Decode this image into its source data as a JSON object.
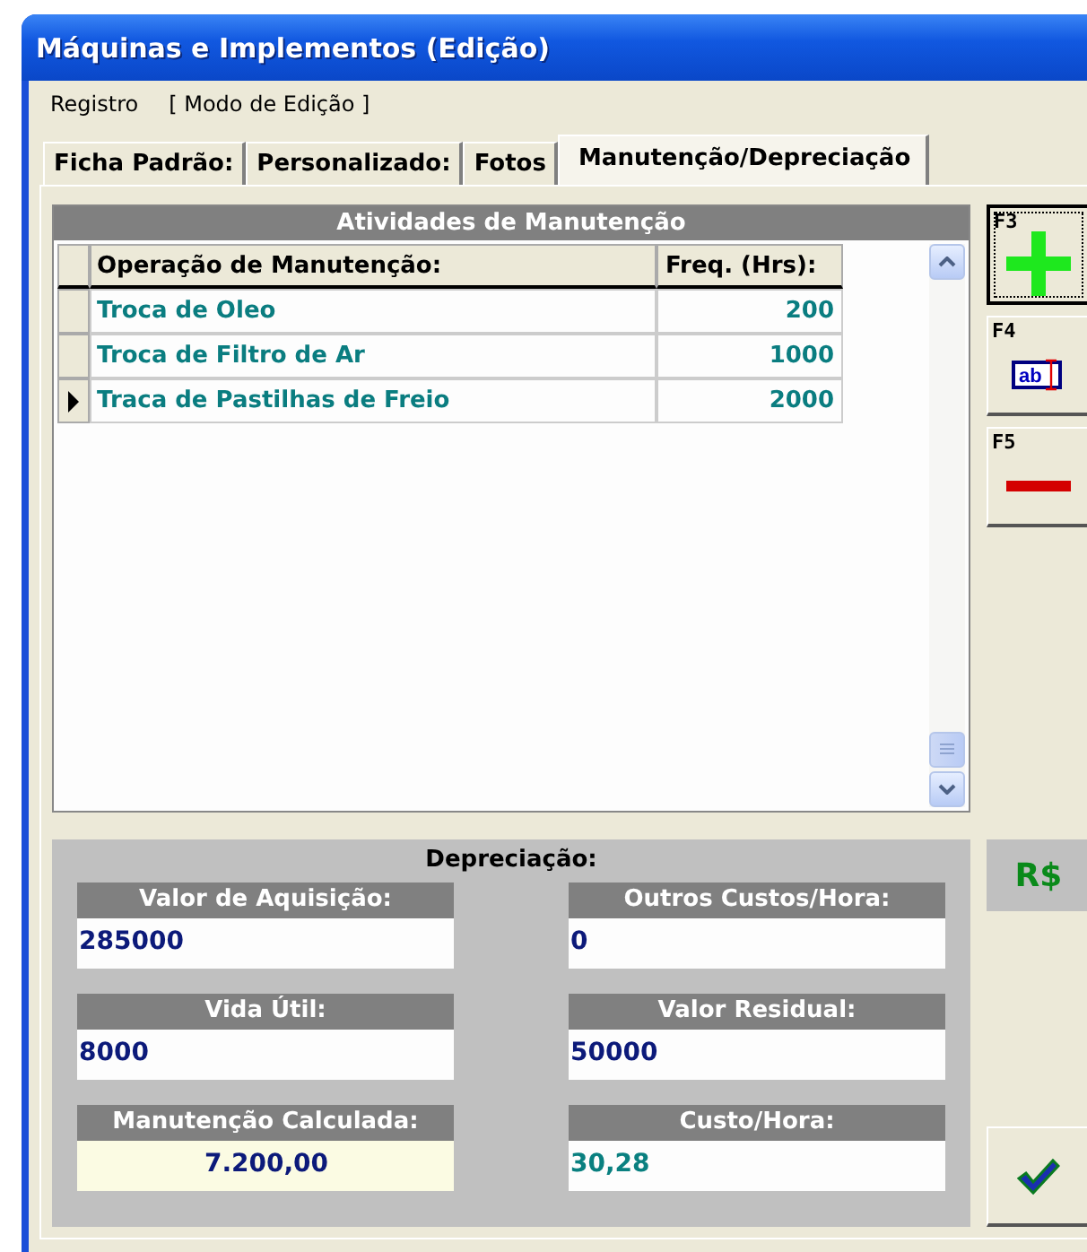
{
  "window": {
    "title": "Máquinas e Implementos (Edição)"
  },
  "menu": [
    "Registro",
    "[ Modo de Edição ]"
  ],
  "tabs": [
    {
      "label": "Ficha Padrão:",
      "selected": false
    },
    {
      "label": "Personalizado:",
      "selected": false
    },
    {
      "label": "Fotos",
      "selected": false
    },
    {
      "label": "Manutenção/Depreciação",
      "selected": true
    }
  ],
  "maintenance": {
    "title": "Atividades de Manutenção",
    "columns": [
      "Operação de Manutenção:",
      "Freq. (Hrs):"
    ],
    "rows": [
      {
        "operation": "Troca de Oleo",
        "freq": "200",
        "selected": false
      },
      {
        "operation": "Troca de Filtro de Ar",
        "freq": "1000",
        "selected": false
      },
      {
        "operation": "Traca de Pastilhas de Freio",
        "freq": "2000",
        "selected": true
      }
    ]
  },
  "side_buttons": [
    {
      "key": "F3",
      "kind": "add"
    },
    {
      "key": "F4",
      "kind": "edit",
      "icon_text": "ab"
    },
    {
      "key": "F5",
      "kind": "remove"
    }
  ],
  "depreciation": {
    "title": "Depreciação:",
    "fields": [
      {
        "label": "Valor de Aquisição:",
        "value": "285000",
        "kind": "input"
      },
      {
        "label": "Outros Custos/Hora:",
        "value": "0",
        "kind": "input"
      },
      {
        "label": "Vida Útil:",
        "value": "8000",
        "kind": "input"
      },
      {
        "label": "Valor Residual:",
        "value": "50000",
        "kind": "input"
      },
      {
        "label": "Manutenção Calculada:",
        "value": "7.200,00",
        "kind": "computed"
      },
      {
        "label": "Custo/Hora:",
        "value": "30,28",
        "kind": "result"
      }
    ]
  },
  "currency_label": "R$"
}
